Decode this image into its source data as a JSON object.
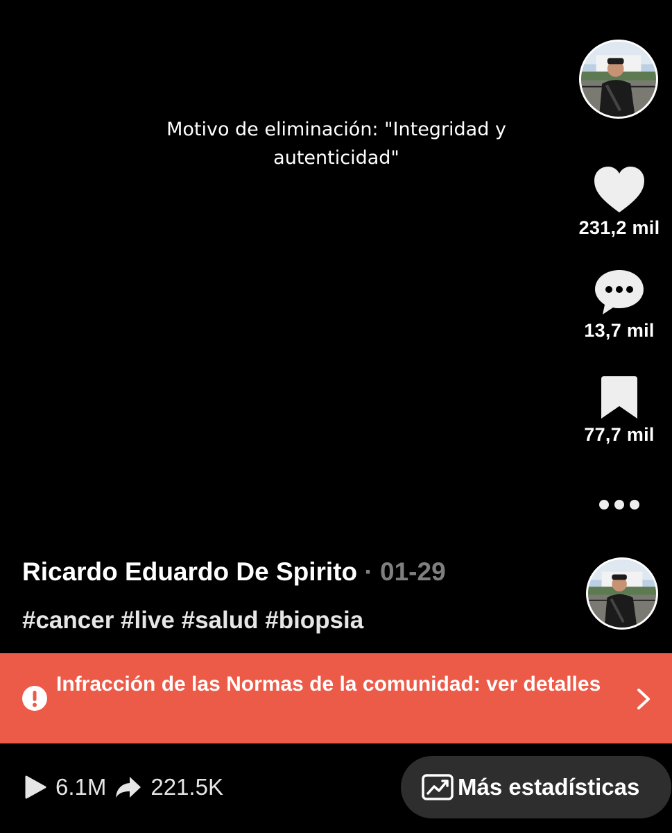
{
  "video": {
    "removal_notice": "Motivo de eliminación: \"Integridad y autenticidad\""
  },
  "sidebar": {
    "likes": "231,2 mil",
    "comments": "13,7 mil",
    "saves": "77,7 mil"
  },
  "post": {
    "author": "Ricardo Eduardo De Spirito",
    "separator": "·",
    "date": "01-29",
    "hashtags": "#cancer #live #salud #biopsia"
  },
  "violation": {
    "text": "Infracción de las Normas de la comunidad: ver detalles",
    "color": "#ec5a48"
  },
  "stats": {
    "views": "6.1M",
    "shares": "221.5K",
    "more_label": "Más estadísticas"
  },
  "icons": {
    "like": "heart-icon",
    "comment": "comment-bubble-icon",
    "save": "bookmark-icon",
    "more": "more-dots-icon",
    "alert": "alert-circle-icon",
    "chevron": "chevron-right-icon",
    "play": "play-icon",
    "share": "share-arrow-icon",
    "analytics": "analytics-chart-icon"
  }
}
